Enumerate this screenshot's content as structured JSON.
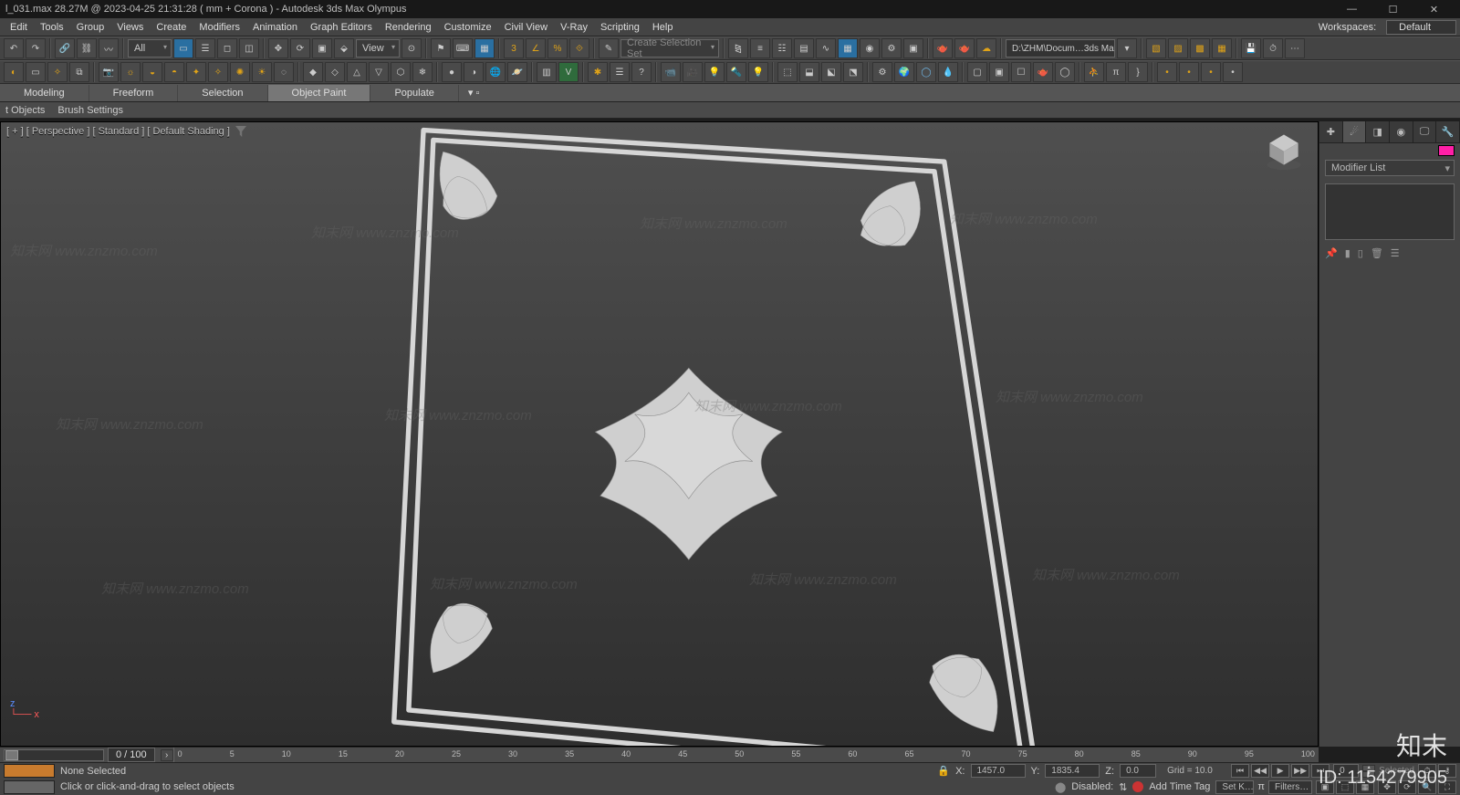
{
  "title": "l_031.max  28.27M @ 2023-04-25 21:31:28  ( mm + Corona ) - Autodesk 3ds Max Olympus",
  "window_controls": {
    "min": "—",
    "max": "☐",
    "close": "✕"
  },
  "menu": [
    "Edit",
    "Tools",
    "Group",
    "Views",
    "Create",
    "Modifiers",
    "Animation",
    "Graph Editors",
    "Rendering",
    "Customize",
    "Civil View",
    "V-Ray",
    "Scripting",
    "Help"
  ],
  "workspaces": {
    "label": "Workspaces:",
    "current": "Default"
  },
  "toolbar1": {
    "filter_label": "All",
    "view_label": "View",
    "selection_set_ph": "Create Selection Set",
    "path": "D:\\ZHM\\Docum…3ds Max 202…"
  },
  "ribbon": {
    "tabs": [
      "Modeling",
      "Freeform",
      "Selection",
      "Object Paint",
      "Populate"
    ],
    "active": "Object Paint",
    "sub": [
      "t Objects",
      "Brush Settings"
    ]
  },
  "viewport": {
    "label": "[ + ]  [ Perspective ]  [ Standard ]  [ Default Shading ]"
  },
  "command_panel": {
    "modifier_list": "Modifier List"
  },
  "trackbar": {
    "frame": "0 / 100",
    "ticks": [
      "0",
      "5",
      "10",
      "15",
      "20",
      "25",
      "30",
      "35",
      "40",
      "45",
      "50",
      "55",
      "60",
      "65",
      "70",
      "75",
      "80",
      "85",
      "90",
      "95",
      "100"
    ]
  },
  "status": {
    "selection": "None Selected",
    "prompt": "Click or  click-and-drag  to select objects",
    "disabled": "Disabled:",
    "x_label": "X:",
    "x_val": "1457.0",
    "y_label": "Y:",
    "y_val": "1835.4",
    "z_label": "Z:",
    "z_val": "0.0",
    "grid": "Grid = 10.0",
    "add_tag": "Add Time Tag",
    "auto_circle": "0",
    "setk": "Set K…",
    "filters": "Filters…",
    "selected_right": "Selected"
  },
  "watermark_text": "知末网 www.znzmo.com",
  "overlay_id": "ID: 1154279905",
  "overlay_brand": "知末"
}
